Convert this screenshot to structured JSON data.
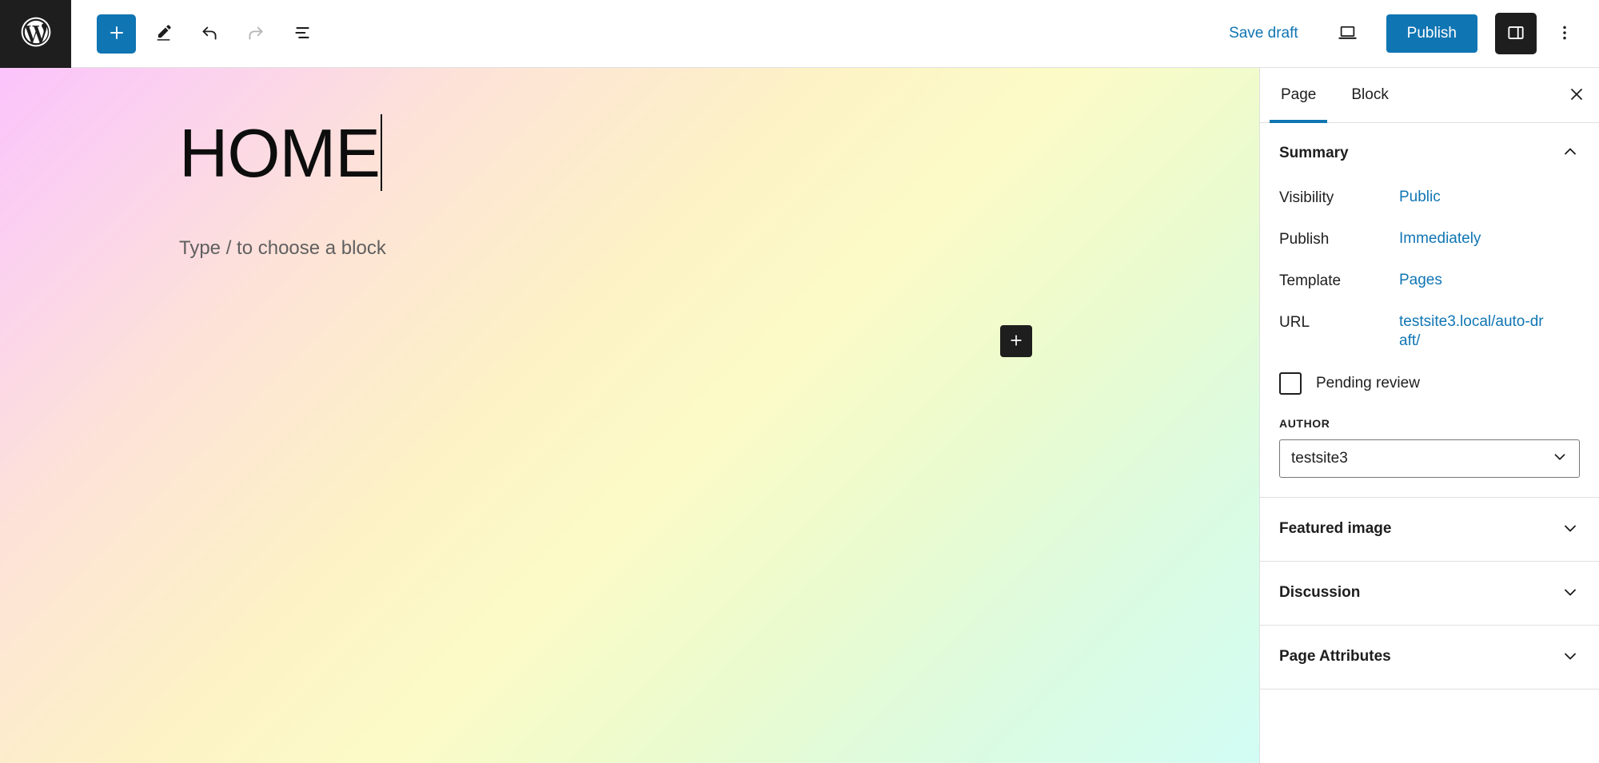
{
  "header": {
    "logo_icon": "wordpress-logo-icon",
    "tools": [
      {
        "name": "add-block-button",
        "icon": "plus-icon",
        "label": "Add block",
        "state": "primary"
      },
      {
        "name": "edit-tool-button",
        "icon": "pencil-icon",
        "label": "Edit",
        "state": "normal"
      },
      {
        "name": "undo-button",
        "icon": "undo-arrow-icon",
        "label": "Undo",
        "state": "normal"
      },
      {
        "name": "redo-button",
        "icon": "redo-arrow-icon",
        "label": "Redo",
        "state": "disabled"
      },
      {
        "name": "document-overview-button",
        "icon": "list-view-icon",
        "label": "Document Overview",
        "state": "normal"
      }
    ],
    "save_draft_label": "Save draft",
    "view_icon": "desktop-preview-icon",
    "publish_label": "Publish",
    "settings_icon": "sidebar-panel-icon",
    "more_menu_icon": "three-dots-vertical-icon",
    "accent_color": "#1075b3",
    "dark_color": "#1e1e1e"
  },
  "canvas": {
    "title": "HOME",
    "block_placeholder": "Type / to choose a block",
    "add_block_icon": "plus-icon",
    "gradient": {
      "top_left": "#fbc3fb",
      "center": "#fcfbc7",
      "bottom_left": "#fde2d8",
      "bottom_right": "#d2fdf4"
    }
  },
  "sidebar": {
    "tabs": [
      {
        "label": "Page",
        "active": true
      },
      {
        "label": "Block",
        "active": false
      }
    ],
    "close_icon": "close-x-icon",
    "summary": {
      "title": "Summary",
      "chevron_icon": "chevron-up-icon",
      "expanded": true,
      "rows": [
        {
          "label": "Visibility",
          "value": "Public"
        },
        {
          "label": "Publish",
          "value": "Immediately"
        },
        {
          "label": "Template",
          "value": "Pages"
        },
        {
          "label": "URL",
          "value": "testsite3.local/auto-draft/"
        }
      ],
      "pending_review": {
        "label": "Pending review",
        "checked": false
      },
      "author": {
        "legend": "AUTHOR",
        "value": "testsite3",
        "options": [
          "testsite3"
        ],
        "chevron_icon": "chevron-down-icon"
      }
    },
    "panels": [
      {
        "label": "Featured image",
        "chevron_icon": "chevron-down-icon",
        "expanded": false
      },
      {
        "label": "Discussion",
        "chevron_icon": "chevron-down-icon",
        "expanded": false
      },
      {
        "label": "Page Attributes",
        "chevron_icon": "chevron-down-icon",
        "expanded": false
      }
    ]
  }
}
